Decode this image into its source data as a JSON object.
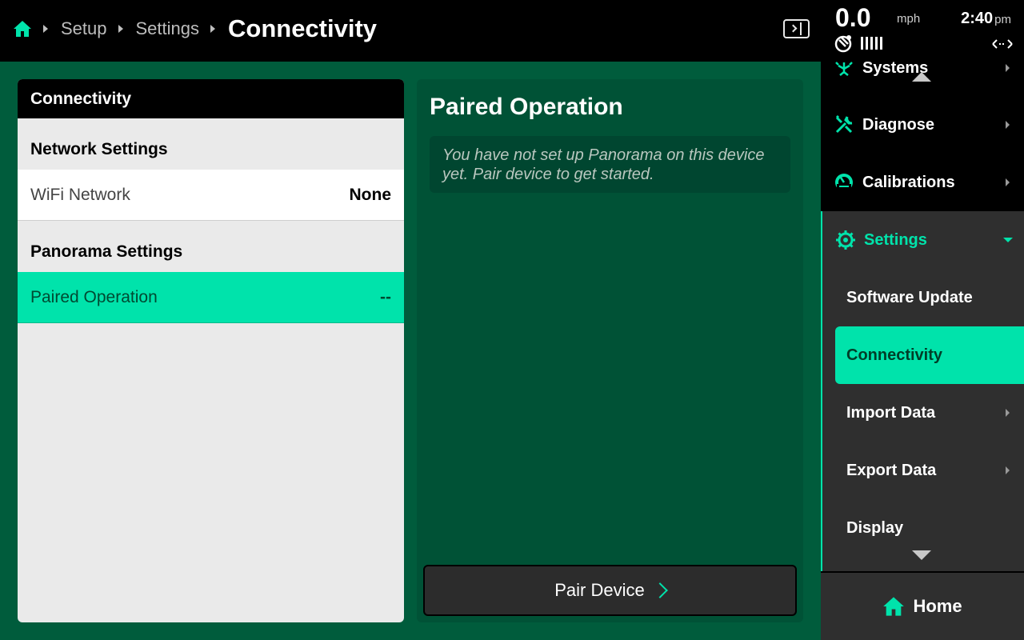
{
  "breadcrumb": {
    "items": [
      "Setup",
      "Settings"
    ],
    "current": "Connectivity"
  },
  "status": {
    "speed": "0.0",
    "speed_unit": "mph",
    "time": "2:40",
    "ampm": "pm"
  },
  "left_card": {
    "title": "Connectivity",
    "network_section": "Network Settings",
    "wifi_label": "WiFi Network",
    "wifi_value": "None",
    "panorama_section": "Panorama Settings",
    "paired_label": "Paired Operation",
    "paired_value": "--"
  },
  "detail": {
    "title": "Paired Operation",
    "notice": "You have not set up Panorama on this device yet. Pair device to get started.",
    "pair_button": "Pair Device"
  },
  "nav": {
    "systems": "Systems",
    "diagnose": "Diagnose",
    "calibrations": "Calibrations",
    "settings": "Settings",
    "software_update": "Software Update",
    "connectivity": "Connectivity",
    "import_data": "Import Data",
    "export_data": "Export Data",
    "display": "Display",
    "home": "Home"
  },
  "colors": {
    "accent": "#00e3ab",
    "background": "#005c3c",
    "panel": "#005236"
  }
}
